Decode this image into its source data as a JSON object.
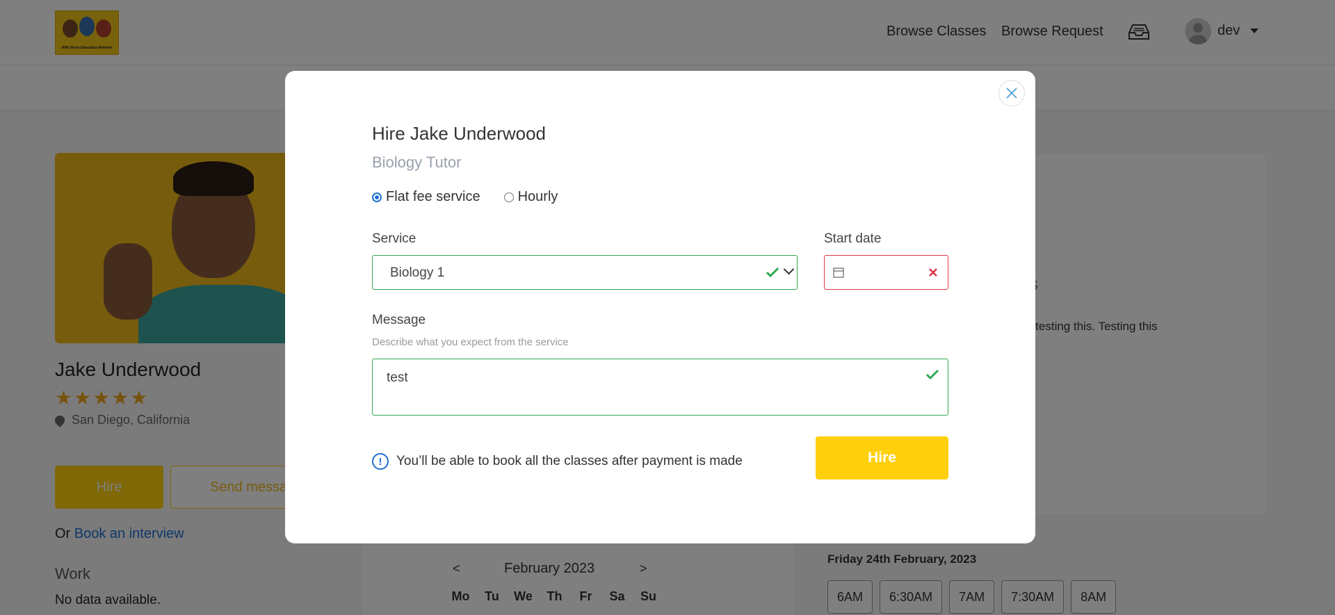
{
  "header": {
    "logo_text": "HNE Home Education Network",
    "nav": [
      "Browse Classes",
      "Browse Request"
    ],
    "user_name": "dev"
  },
  "profile": {
    "name": "Jake Underwood",
    "rating_stars": 5,
    "location": "San Diego, California",
    "hire_label": "Hire",
    "send_message_label": "Send message",
    "or_text": "Or ",
    "book_interview_label": "Book an interview",
    "work_title": "Work",
    "no_data": "No data available."
  },
  "right_panel": {
    "heading_fragment": "s",
    "text_fragment": "n testing this. Testing this"
  },
  "calendar": {
    "prev": "<",
    "next": ">",
    "month": "February 2023",
    "days": [
      "Mo",
      "Tu",
      "We",
      "Th",
      "Fr",
      "Sa",
      "Su"
    ],
    "selected_date": "Friday 24th February, 2023",
    "slots": [
      "6AM",
      "6:30AM",
      "7AM",
      "7:30AM",
      "8AM"
    ]
  },
  "modal": {
    "title": "Hire Jake Underwood",
    "subtitle": "Biology Tutor",
    "options": [
      "Flat fee service",
      "Hourly"
    ],
    "selected_option": "Flat fee service",
    "service_label": "Service",
    "service_value": "Biology 1",
    "start_date_label": "Start date",
    "start_date_value": "",
    "message_label": "Message",
    "message_help": "Describe what you expect from the service",
    "message_value": "test",
    "info_text": "You’ll be able to book all the classes after payment is made",
    "hire_button": "Hire"
  },
  "colors": {
    "accent_yellow": "#ffd00b",
    "valid_green": "#2fa84f",
    "invalid_red": "#dc3545",
    "link_blue": "#1f6fd1"
  }
}
